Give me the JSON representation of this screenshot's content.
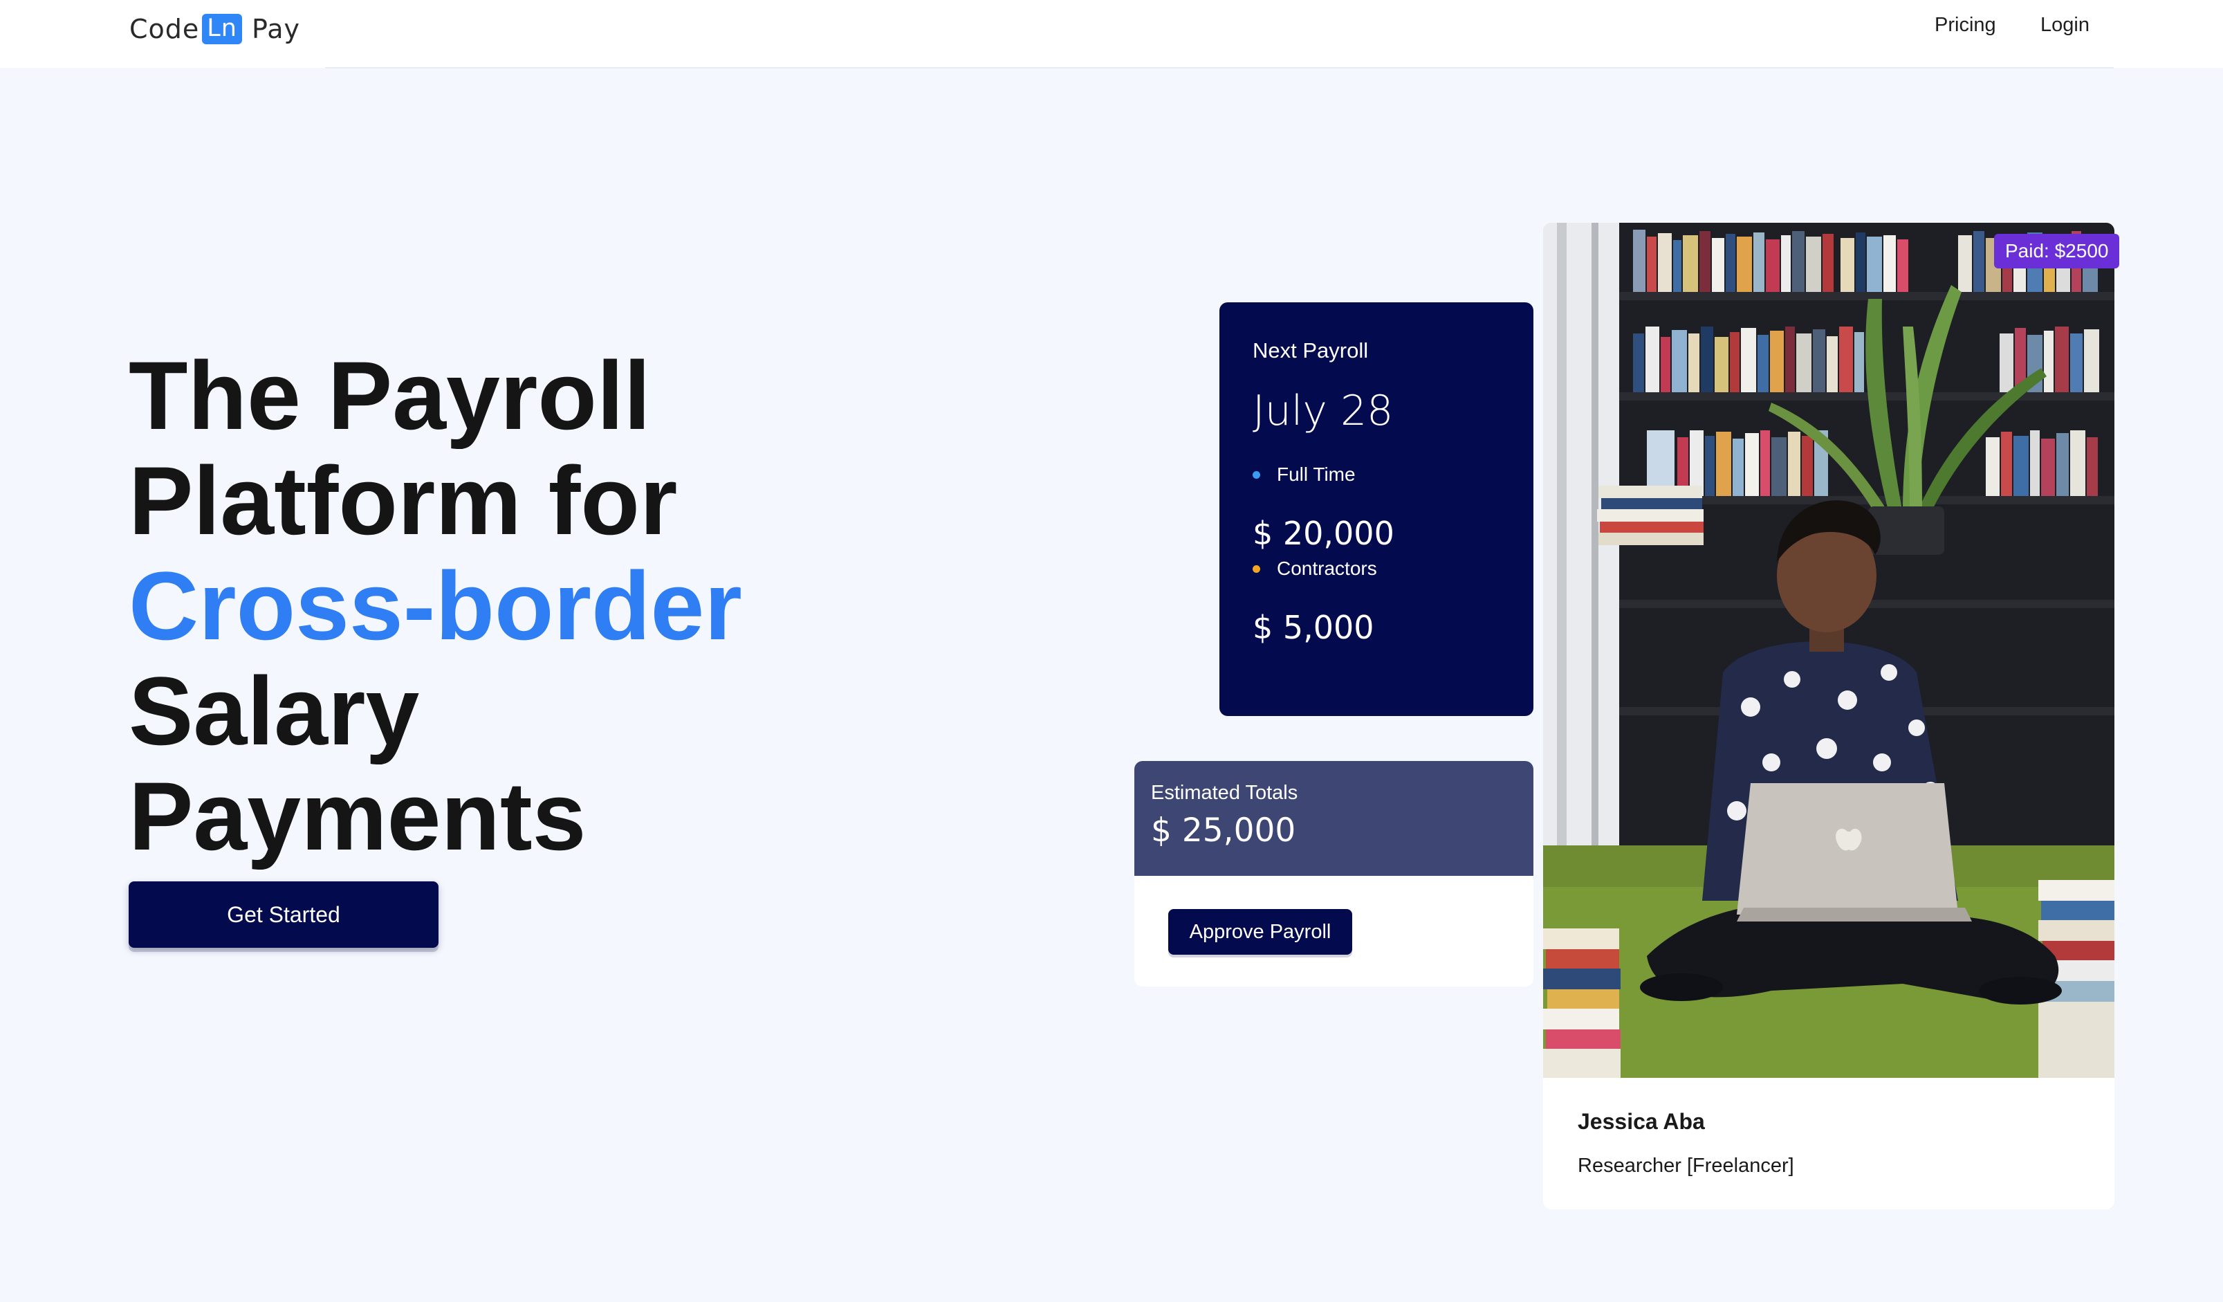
{
  "brand": {
    "code": "Code",
    "ln": "Ln",
    "pay": "Pay"
  },
  "nav": {
    "pricing": "Pricing",
    "login": "Login"
  },
  "hero": {
    "line1": "The Payroll",
    "line2": "Platform for",
    "line3": "Cross-border",
    "line4": "Salary",
    "line5": "Payments",
    "cta": "Get Started"
  },
  "next_payroll": {
    "title": "Next Payroll",
    "date": "July 28",
    "full_time_label": "Full Time",
    "full_time_amount": "$ 20,000",
    "contractors_label": "Contractors",
    "contractors_amount": "$ 5,000"
  },
  "estimate": {
    "label": "Estimated Totals",
    "value": "$ 25,000",
    "approve": "Approve Payroll"
  },
  "profile": {
    "name": "Jessica Aba",
    "role": "Researcher [Freelancer]",
    "paid_badge": "Paid: $2500"
  },
  "colors": {
    "navy": "#040a4e",
    "accent_blue": "#2f7ef3",
    "slate": "#3e4674",
    "badge_purple": "#6a2fd6",
    "full_time_dot": "#3b9cf5",
    "contractors_dot": "#f5a623"
  }
}
